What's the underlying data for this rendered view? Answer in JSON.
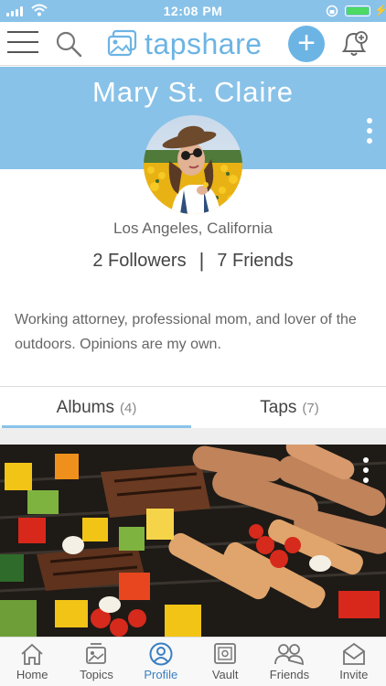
{
  "status_bar": {
    "time": "12:08 PM",
    "battery_level": 1.0,
    "battery_color": "#4cd964"
  },
  "nav": {
    "logo_text": "tapshare",
    "menu_icon": "hamburger-icon",
    "search_icon": "search-icon",
    "add_icon": "plus-icon",
    "notification_icon": "bell-icon"
  },
  "profile": {
    "name": "Mary St. Claire",
    "location": "Los Angeles, California",
    "followers": "2 Followers",
    "separator": "|",
    "friends": "7 Friends",
    "bio": "Working attorney, professional mom, and lover of the outdoors.  Opinions are my own."
  },
  "tabs": [
    {
      "label": "Albums",
      "count": "(4)",
      "active": true
    },
    {
      "label": "Taps",
      "count": "(7)",
      "active": false
    }
  ],
  "bottom_tabs": [
    {
      "label": "Home",
      "icon": "home-icon",
      "active": false
    },
    {
      "label": "Topics",
      "icon": "topics-icon",
      "active": false
    },
    {
      "label": "Profile",
      "icon": "profile-icon",
      "active": true
    },
    {
      "label": "Vault",
      "icon": "vault-icon",
      "active": false
    },
    {
      "label": "Friends",
      "icon": "friends-icon",
      "active": false
    },
    {
      "label": "Invite",
      "icon": "invite-icon",
      "active": false
    }
  ],
  "colors": {
    "brand": "#6cb4e4",
    "header_bg": "#89c2e8",
    "active_tab": "#3a7fc1"
  }
}
